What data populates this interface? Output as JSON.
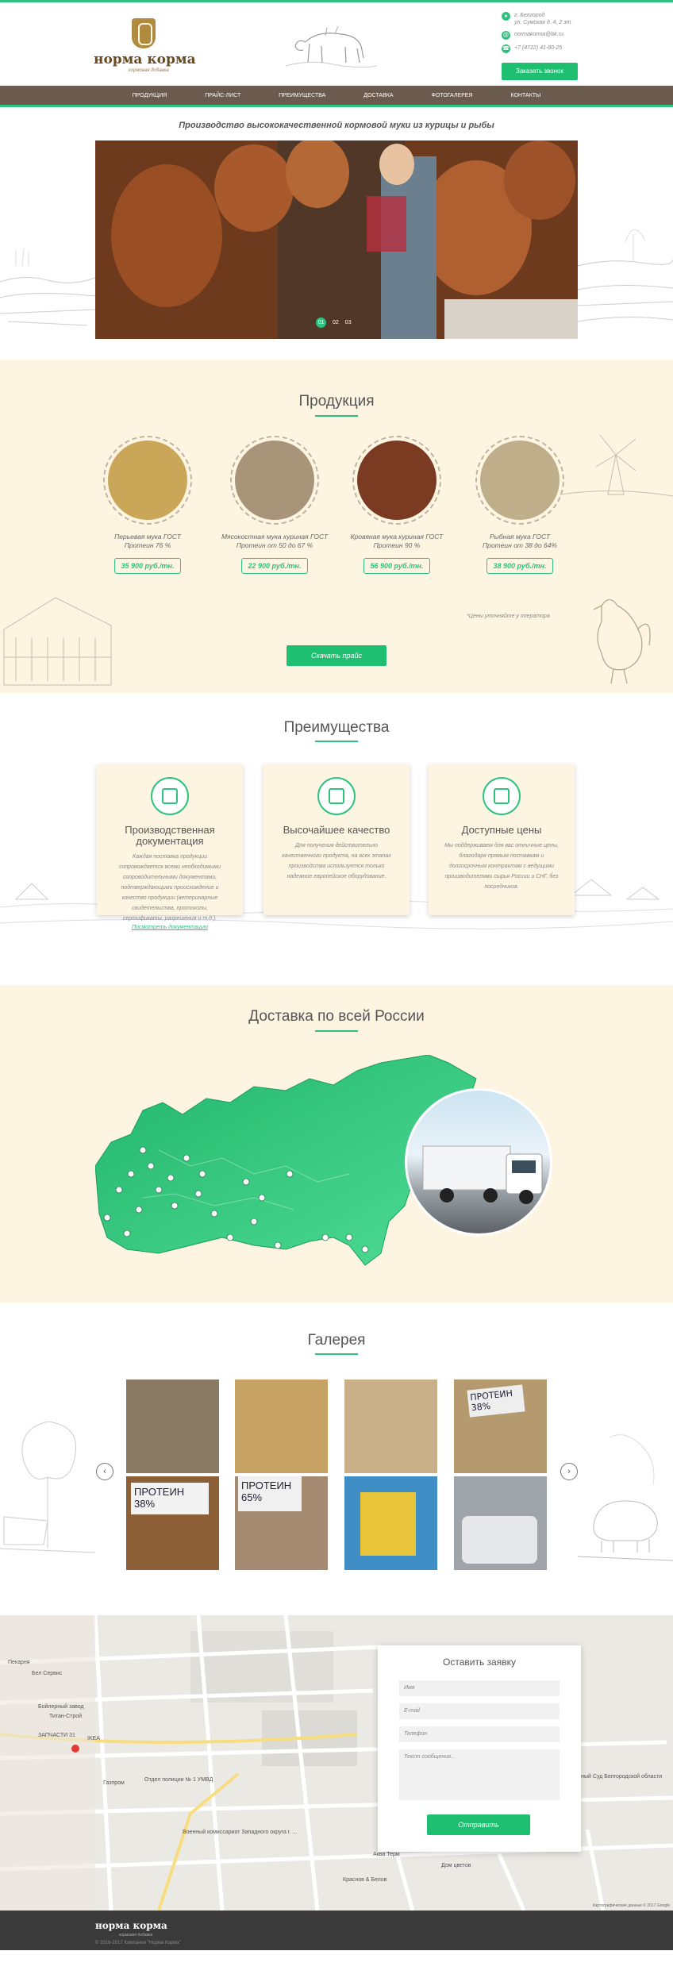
{
  "header": {
    "logo_title": "норма корма",
    "logo_sub": "кормовая добавка",
    "address_line1": "г. Белгород",
    "address_line2": "ул. Сумская д. 4, 2 эт.",
    "email": "normakorma@bk.ru",
    "phone": "+7 (4722) 41-80-25",
    "call_button": "Заказать звонок"
  },
  "nav": [
    "ПРОДУКЦИЯ",
    "ПРАЙС-ЛИСТ",
    "ПРЕИМУЩЕСТВА",
    "ДОСТАВКА",
    "ФОТОГАЛЕРЕЯ",
    "КОНТАКТЫ"
  ],
  "hero": {
    "tagline": "Производство высококачественной кормовой муки из курицы и рыбы",
    "slides": [
      "01",
      "02",
      "03"
    ]
  },
  "products": {
    "title": "Продукция",
    "items": [
      {
        "name1": "Перьевая мука ГОСТ",
        "name2": "Протеин 76 %",
        "price": "35 900 руб./тн.",
        "color": "#c9a658"
      },
      {
        "name1": "Мясокостная мука куриная ГОСТ",
        "name2": "Протеин от 50 до 67 %",
        "price": "22 900 руб./тн.",
        "color": "#a89478"
      },
      {
        "name1": "Кровяная мука куриная ГОСТ",
        "name2": "Протеин 90 %",
        "price": "56 900 руб./тн.",
        "color": "#7a3b22"
      },
      {
        "name1": "Рыбная мука ГОСТ",
        "name2": "Протеин от 38 до 64%",
        "price": "38 900 руб./тн.",
        "color": "#bfae8a"
      }
    ],
    "note": "*Цены уточняйте у оператора",
    "download_button": "Скачать прайс"
  },
  "advantages": {
    "title": "Преимущества",
    "items": [
      {
        "title": "Производственная документация",
        "text": "Каждая поставка продукции сопровождается всеми необходимыми сопроводительными документами, подтверждающими происхождение и качество продукции (ветеринарные свидетельства, протоколы, сертификаты, разрешения и т.д.).",
        "link": "Посмотреть документацию"
      },
      {
        "title": "Высочайшее качество",
        "text": "Для получения действительно качественного продукта, на всех этапах производства используется только надежное европейское оборудование.",
        "link": ""
      },
      {
        "title": "Доступные цены",
        "text": "Мы поддерживаем для вас отличные цены, благодаря прямым поставкам и долгосрочным контрактам с ведущими производителями сырья России и СНГ, без посредников.",
        "link": ""
      }
    ]
  },
  "delivery": {
    "title": "Доставка по всей России"
  },
  "gallery": {
    "title": "Галерея",
    "prev": "‹",
    "next": "›",
    "images": [
      {
        "label": "",
        "color": "#8a7a63"
      },
      {
        "label": "",
        "color": "#c6a265"
      },
      {
        "label": "",
        "color": "#c9b088"
      },
      {
        "label": "ПРОТЕИН 38%",
        "color": "#b49a6e"
      },
      {
        "label": "ПРОТЕИН 38%",
        "color": "#8c5f37"
      },
      {
        "label": "ПРОТЕИН 65%",
        "color": "#a58a72"
      },
      {
        "label": "",
        "color": "#3f8fc6"
      },
      {
        "label": "",
        "color": "#9ea4aa"
      }
    ]
  },
  "contact_form": {
    "title": "Оставить заявку",
    "name_placeholder": "Имя",
    "email_placeholder": "E-mail",
    "phone_placeholder": "Телефон",
    "message_placeholder": "Текст сообщения...",
    "submit": "Отправить"
  },
  "map": {
    "labels": [
      "Пекарня",
      "Бел Сервис",
      "Бойлерный завод",
      "Титан-Строй",
      "ЗАПЧАСТИ 31",
      "IKEA",
      "Газпром",
      "Отдел полиции № 1 УМВД",
      "Военный комиссариат Западного округа г. ...",
      "Аква Терм",
      "Дом цветов",
      "Краснов & Белов",
      "Арбитражный Суд Белгородской области"
    ],
    "copyright": "Картографические данные © 2017 Google"
  },
  "footer": {
    "logo": "норма корма",
    "sub": "кормовая добавка",
    "copyright": "© 2016-2017 Компания \"Норма Корма\""
  }
}
